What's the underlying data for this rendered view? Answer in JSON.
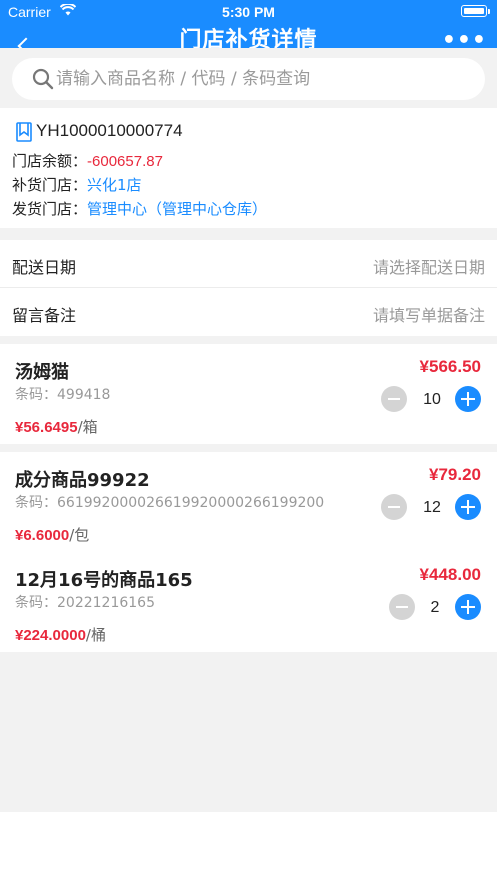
{
  "status_bar": {
    "carrier": "Carrier",
    "time": "5:30 PM"
  },
  "header": {
    "title": "门店补货详情",
    "more": "•••"
  },
  "search": {
    "placeholder": "请输入商品名称 / 代码 / 条码查询"
  },
  "order": {
    "number": "YH1000010000774",
    "balance_label": "门店余额：",
    "balance_value": "-600657.87",
    "store_label": "补货门店：",
    "store_value": "兴化1店",
    "ship_label": "发货门店：",
    "ship_value": "管理中心（管理中心仓库）"
  },
  "fields": {
    "delivery_label": "配送日期",
    "delivery_placeholder": "请选择配送日期",
    "remark_label": "留言备注",
    "remark_placeholder": "请填写单据备注"
  },
  "items": [
    {
      "name": "汤姆猫",
      "code": "条码：499418",
      "total": "¥566.50",
      "unit_price": "¥56.6495",
      "unit": "/箱",
      "qty": "10"
    },
    {
      "name": "成分商品99922",
      "code": "条码：661992000026619920000266199200",
      "total": "¥79.20",
      "unit_price": "¥6.6000",
      "unit": "/包",
      "qty": "12"
    },
    {
      "name": "12月16号的商品165",
      "code": "条码：20221216165",
      "total": "¥448.00",
      "unit_price": "¥224.0000",
      "unit": "/桶",
      "qty": "2"
    }
  ],
  "colors": {
    "primary": "#1a8cff",
    "price": "#e8283c"
  }
}
